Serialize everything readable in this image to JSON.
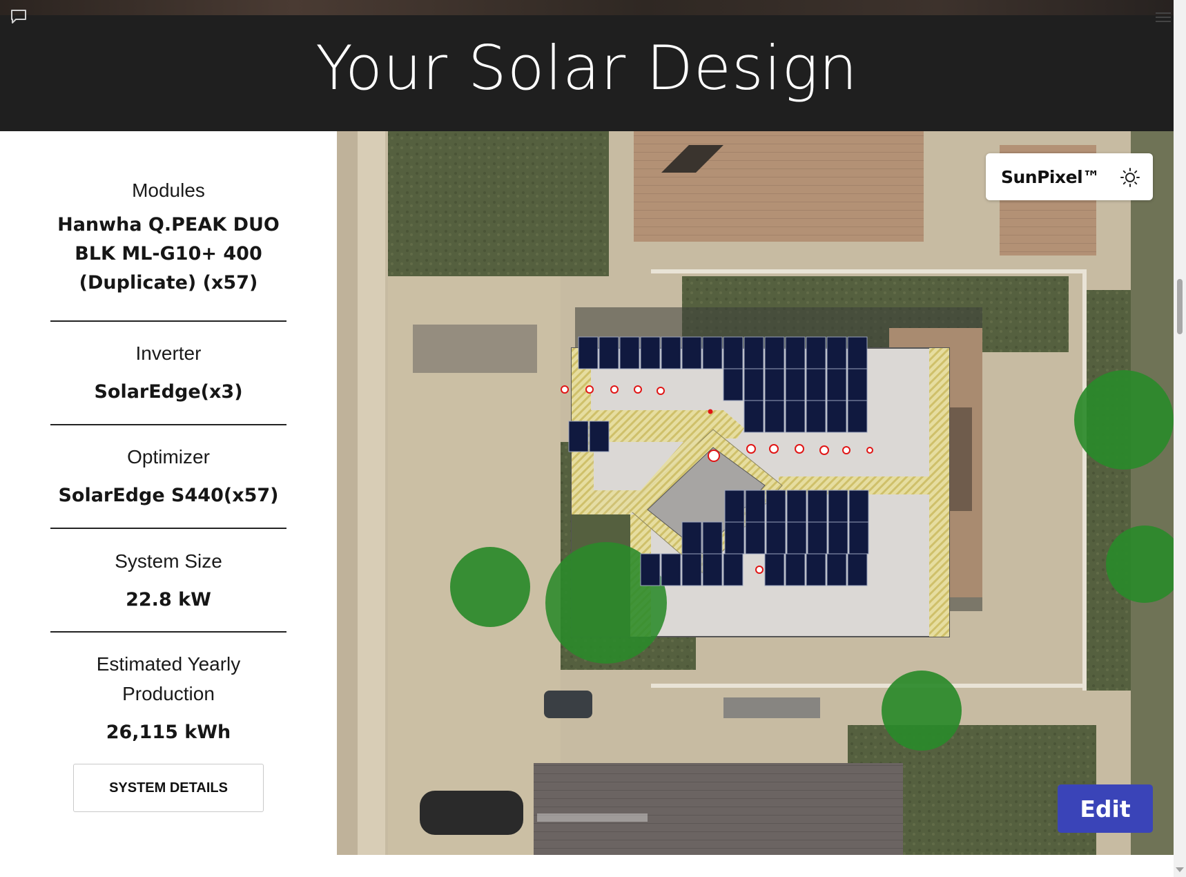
{
  "header": {
    "title": "Your Solar Design"
  },
  "icons": {
    "chat": "chat-icon",
    "menu": "menu-icon",
    "sun": "sun-icon"
  },
  "sidebar": {
    "modules": {
      "label": "Modules",
      "value_lines": [
        "Hanwha Q.PEAK DUO",
        "BLK ML-G10+ 400",
        "(Duplicate) (x57)"
      ]
    },
    "inverter": {
      "label": "Inverter",
      "value": "SolarEdge(x3)"
    },
    "optimizer": {
      "label": "Optimizer",
      "value": "SolarEdge S440(x57)"
    },
    "system_size": {
      "label": "System Size",
      "value": "22.8 kW"
    },
    "production": {
      "label_lines": [
        "Estimated Yearly",
        "Production"
      ],
      "value": "26,115 kWh"
    },
    "details_button": "SYSTEM DETAILS"
  },
  "map": {
    "sunpixel_label": "SunPixel™",
    "edit_button": "Edit",
    "colors": {
      "panel": "#10193f",
      "roof": "#dcd9d6",
      "setback": "#ece59a",
      "tree": "#2a8a2a",
      "obstruction": "#e01515",
      "edit_button": "#3a44b8"
    },
    "panel_count": 57
  }
}
